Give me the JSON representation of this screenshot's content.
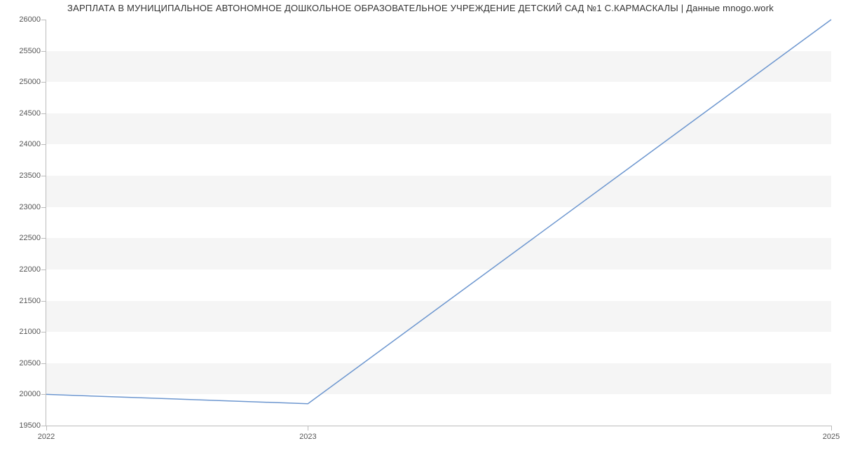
{
  "chart_data": {
    "type": "line",
    "title": "ЗАРПЛАТА В МУНИЦИПАЛЬНОЕ АВТОНОМНОЕ ДОШКОЛЬНОЕ ОБРАЗОВАТЕЛЬНОЕ УЧРЕЖДЕНИЕ ДЕТСКИЙ САД №1 С.КАРМАСКАЛЫ | Данные mnogo.work",
    "xlabel": "",
    "ylabel": "",
    "x": [
      2022,
      2023,
      2025
    ],
    "values": [
      20000,
      19850,
      26000
    ],
    "x_ticks": [
      2022,
      2023,
      2025
    ],
    "y_ticks": [
      19500,
      20000,
      20500,
      21000,
      21500,
      22000,
      22500,
      23000,
      23500,
      24000,
      24500,
      25000,
      25500,
      26000
    ],
    "ylim": [
      19500,
      26000
    ],
    "xlim": [
      2022,
      2025
    ],
    "line_color": "#6c96cf"
  }
}
